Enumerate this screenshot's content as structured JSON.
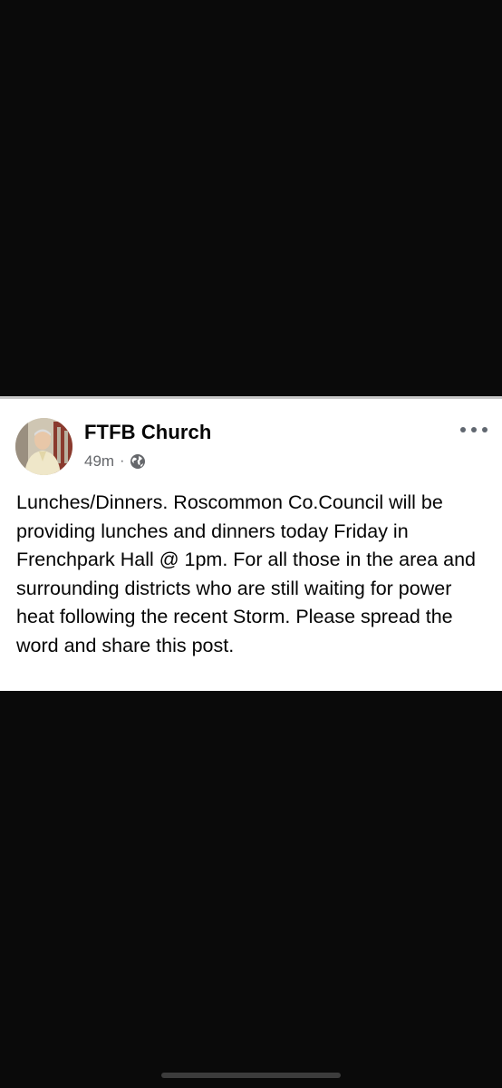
{
  "post": {
    "author": "FTFB Church",
    "time": "49m",
    "separator": "·",
    "audience_icon": "globe-icon",
    "menu_icon": "more-options-icon",
    "text": "Lunches/Dinners.  Roscommon Co.Council will be providing lunches and dinners today Friday in Frenchpark Hall @ 1pm.  For all those in the area and surrounding districts who are still waiting for power heat  following the recent Storm. Please spread the word and share this post."
  },
  "colors": {
    "background": "#0a0a0a",
    "card": "#ffffff",
    "text": "#050505",
    "meta": "#65676b"
  }
}
